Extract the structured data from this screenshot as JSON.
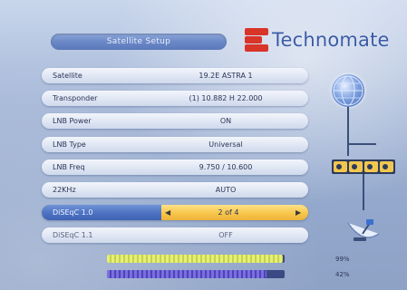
{
  "header": {
    "title": "Satellite Setup",
    "brand": "Technomate"
  },
  "settings": [
    {
      "label": "Satellite",
      "value": "19.2E ASTRA 1"
    },
    {
      "label": "Transponder",
      "value": "(1) 10.882 H 22.000"
    },
    {
      "label": "LNB Power",
      "value": "ON"
    },
    {
      "label": "LNB Type",
      "value": "Universal"
    },
    {
      "label": "LNB Freq",
      "value": "9.750 / 10.600"
    },
    {
      "label": "22KHz",
      "value": "AUTO"
    },
    {
      "label": "DiSEqC 1.0",
      "value": "2 of 4",
      "left_arrow": "◀",
      "right_arrow": "▶"
    },
    {
      "label": "DiSEqC 1.1",
      "value": "OFF"
    }
  ],
  "signal": {
    "strength_label": "99%",
    "strength": 0.99,
    "quality_label": "42%",
    "quality": 0.9
  },
  "icons": [
    "technomate-logo-icon",
    "globe-icon",
    "diseqc-switch-icon",
    "satellite-dish-icon"
  ],
  "colors": {
    "selected_label": "#4d72c2",
    "selected_value": "#f7c64a",
    "brand_red": "#d83428",
    "brand_blue": "#3a5aa6"
  }
}
